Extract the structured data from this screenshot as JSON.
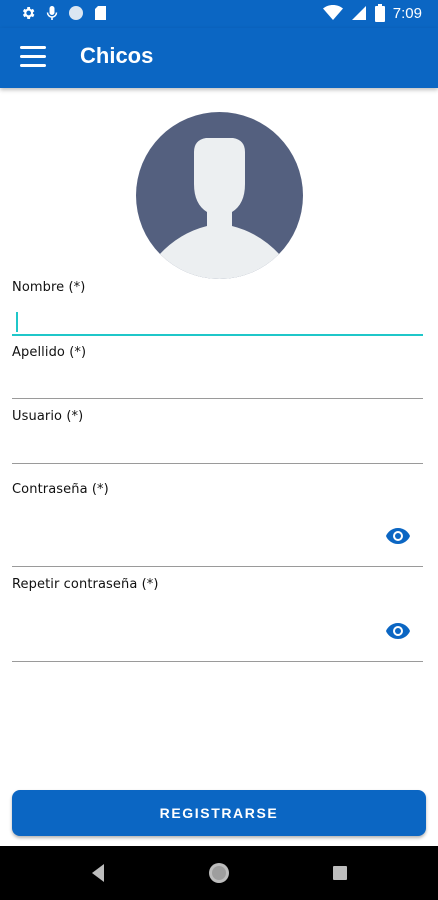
{
  "status_bar": {
    "time": "7:09",
    "icons": [
      "settings-icon",
      "microphone-icon",
      "circle-icon",
      "sd-card-icon",
      "wifi-icon",
      "signal-icon",
      "battery-icon"
    ]
  },
  "app_bar": {
    "title": "Chicos",
    "menu_icon": "hamburger-menu-icon"
  },
  "avatar": {
    "icon": "person-placeholder-icon"
  },
  "form": {
    "fields": [
      {
        "label": "Nombre (*)",
        "value": "",
        "focused": true
      },
      {
        "label": "Apellido (*)",
        "value": ""
      },
      {
        "label": "Usuario (*)",
        "value": ""
      },
      {
        "label": "Contraseña (*)",
        "value": "",
        "toggle_icon": "eye-icon"
      },
      {
        "label": "Repetir contraseña (*)",
        "value": "",
        "toggle_icon": "eye-icon"
      }
    ],
    "submit_label": "REGISTRARSE"
  },
  "nav_bar": {
    "items": [
      "back-icon",
      "home-icon",
      "recents-icon"
    ]
  },
  "colors": {
    "primary": "#0b66c3",
    "accent": "#1fc7c9",
    "avatar_bg": "#54607f"
  }
}
